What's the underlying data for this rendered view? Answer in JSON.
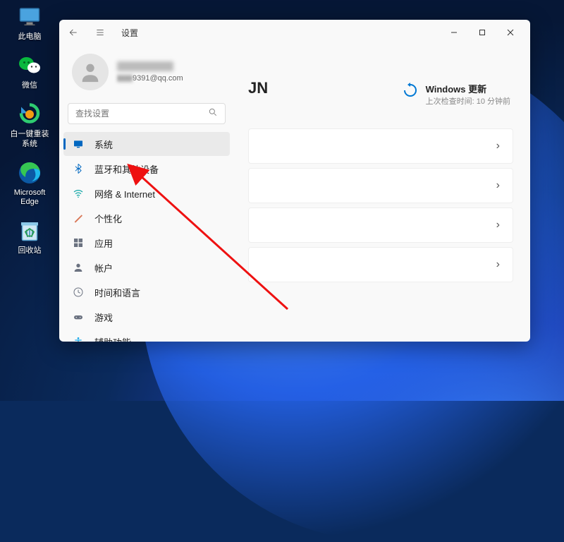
{
  "desktop": {
    "icons": [
      {
        "name": "this-pc",
        "label": "此电脑"
      },
      {
        "name": "wechat",
        "label": "微信"
      },
      {
        "name": "reinstall",
        "label": "白一键重装\n系统"
      },
      {
        "name": "edge",
        "label": "Microsoft\nEdge"
      },
      {
        "name": "recycle",
        "label": "回收站"
      }
    ]
  },
  "window": {
    "title": "设置",
    "profile": {
      "email_partial": "9391@qq.com"
    },
    "search_placeholder": "查找设置",
    "nav": [
      {
        "id": "system",
        "label": "系统",
        "active": true
      },
      {
        "id": "bluetooth",
        "label": "蓝牙和其他设备"
      },
      {
        "id": "network",
        "label": "网络 & Internet"
      },
      {
        "id": "personalize",
        "label": "个性化"
      },
      {
        "id": "apps",
        "label": "应用"
      },
      {
        "id": "accounts",
        "label": "帐户"
      },
      {
        "id": "time",
        "label": "时间和语言"
      },
      {
        "id": "gaming",
        "label": "游戏"
      },
      {
        "id": "accessibility",
        "label": "辅助功能"
      }
    ],
    "main_heading": "JN",
    "update": {
      "title": "Windows 更新",
      "subtitle": "上次检查时间: 10 分钟前"
    },
    "card_count": 4
  },
  "colors": {
    "accent": "#0067c0",
    "link": "#0078d4"
  }
}
